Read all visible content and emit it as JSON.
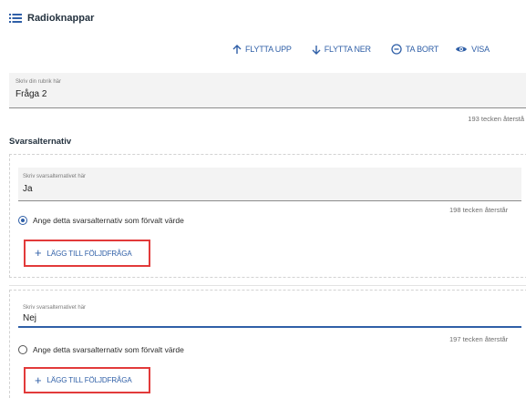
{
  "header": {
    "title": "Radioknappar",
    "icon": "list-icon"
  },
  "toolbar": {
    "move_up": "FLYTTA UPP",
    "move_down": "FLYTTA NER",
    "remove": "TA BORT",
    "show": "VISA"
  },
  "question": {
    "label": "Skriv din rubrik här",
    "value": "Fråga 2",
    "counter": "193 tecken återstå"
  },
  "answers_section": {
    "title": "Svarsalternativ"
  },
  "answers": [
    {
      "label": "Skriv svarsalternativet här",
      "value": "Ja",
      "counter": "198 tecken återstår",
      "radio_label": "Ange detta svarsalternativ som förvalt värde",
      "radio_checked": true,
      "add_followup": "LÄGG TILL FÖLJDFRÅGA"
    },
    {
      "label": "Skriv svarsalternativet här",
      "value": "Nej",
      "counter": "197 tecken återstår",
      "radio_label": "Ange detta svarsalternativ som förvalt värde",
      "radio_checked": false,
      "add_followup": "LÄGG TILL FÖLJDFRÅGA"
    }
  ],
  "colors": {
    "accent": "#2f5fa7",
    "highlight": "#e23a3a"
  }
}
